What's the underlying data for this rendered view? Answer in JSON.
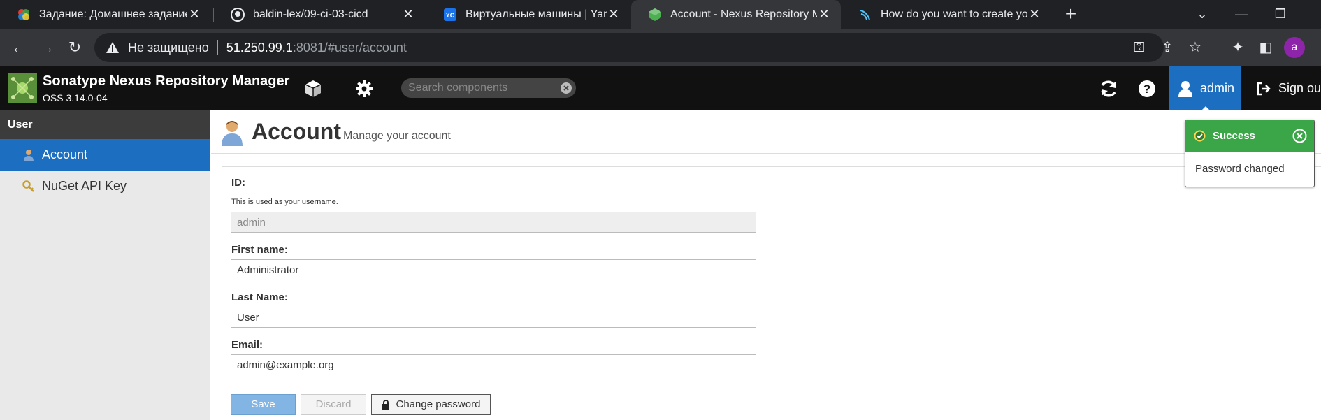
{
  "browser": {
    "tabs": [
      {
        "title": "Задание: Домашнее задание \"П",
        "active": false,
        "icon": "colorful-app-icon"
      },
      {
        "title": "baldin-lex/09-ci-03-cicd",
        "active": false,
        "icon": "github-icon"
      },
      {
        "title": "Виртуальные машины | Yandex C",
        "active": false,
        "icon": "yandex-cloud-icon"
      },
      {
        "title": "Account - Nexus Repository Man",
        "active": true,
        "icon": "nexus-icon"
      },
      {
        "title": "How do you want to create your",
        "active": false,
        "icon": "jenkins-icon"
      }
    ],
    "address": {
      "security_label": "Не защищено",
      "url_host": "51.250.99.1",
      "url_rest": ":8081/#user/account"
    },
    "profile_initial": "a"
  },
  "app": {
    "name": "Sonatype Nexus Repository Manager",
    "version": "OSS 3.14.0-04",
    "search_placeholder": "Search components",
    "user_label": "admin",
    "signout_label": "Sign out"
  },
  "sidebar": {
    "heading": "User",
    "items": [
      {
        "label": "Account",
        "active": true
      },
      {
        "label": "NuGet API Key",
        "active": false
      }
    ]
  },
  "page": {
    "title": "Account",
    "subtitle": "Manage your account"
  },
  "form": {
    "id_label": "ID:",
    "id_help": "This is used as your username.",
    "id_value": "admin",
    "first_name_label": "First name:",
    "first_name_value": "Administrator",
    "last_name_label": "Last Name:",
    "last_name_value": "User",
    "email_label": "Email:",
    "email_value": "admin@example.org",
    "save_label": "Save",
    "discard_label": "Discard",
    "change_password_label": "Change password"
  },
  "toast": {
    "title": "Success",
    "message": "Password changed"
  },
  "colors": {
    "accent": "#1c6fc0",
    "success": "#3aa648",
    "header_bg": "#111111"
  }
}
